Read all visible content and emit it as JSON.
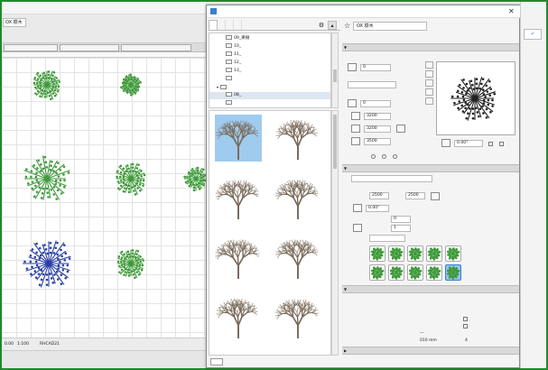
{
  "colors": {
    "frame": "#1f8a2c",
    "plant_green": "#3f9a3a",
    "plant_blue": "#2a3fa8",
    "selection": "#2f6fcc",
    "preview_bg": "#9fcbee"
  },
  "background": {
    "menu": [
      "",
      "",
      "",
      "",
      "",
      "",
      "",
      ""
    ],
    "layer_field": "OX 樹木",
    "tabs": [
      "",
      "",
      ""
    ],
    "note": "",
    "status": {
      "value1": "0.00",
      "scale": "1:100",
      "item1": "",
      "item2": "",
      "item3": "RHCAD21"
    }
  },
  "dialog": {
    "title": "",
    "close": "✕",
    "tabs": [
      "",
      "",
      "",
      ""
    ],
    "tree": [
      {
        "label": "09_果樹",
        "indent": 2
      },
      {
        "label": "10_",
        "indent": 2
      },
      {
        "label": "11_",
        "indent": 2
      },
      {
        "label": "12_",
        "indent": 2
      },
      {
        "label": "13_",
        "indent": 2
      },
      {
        "label": "",
        "indent": 2
      },
      {
        "label": "",
        "indent": 1,
        "chev": "v"
      },
      {
        "label": "08_",
        "indent": 2,
        "selected": true
      },
      {
        "label": "",
        "indent": 2
      }
    ],
    "tiles": [
      {
        "label": "",
        "selected": true
      },
      {
        "label": "",
        "selected": false
      },
      {
        "label": "",
        "selected": false
      },
      {
        "label": "",
        "selected": false
      },
      {
        "label": "",
        "selected": false
      },
      {
        "label": "",
        "selected": false
      },
      {
        "label": "",
        "selected": false
      },
      {
        "label": "",
        "selected": false
      }
    ],
    "right": {
      "element": "OX 樹木",
      "element_label": "",
      "right_label": "",
      "sec_preview": "",
      "value_zero1": "0",
      "sec_label2": "",
      "floor_select": "",
      "sec_label3": "",
      "value_zero2": "0",
      "dim_w": "3200",
      "dim_d": "3200",
      "dim_h": "3500",
      "rotation_value": "0.00°",
      "radio_none": "",
      "radio_label": "",
      "radio_label2": "",
      "sec_custom": "",
      "custom_select": "",
      "f_a": "2500",
      "f_b": "2500",
      "f_c": "0.00°",
      "f_d": "0",
      "f_e": "1",
      "sec_plan": "",
      "plan_sub": "",
      "plan_floor_label": "",
      "plan_floor_value": "",
      "sec_symbol": "",
      "opt1": "",
      "opt2": "",
      "opt3": "",
      "pen_label": "",
      "pen_value": "010 mm",
      "pen_num": "4",
      "sec_model": "",
      "cancel": "",
      "ok": "OK"
    }
  }
}
